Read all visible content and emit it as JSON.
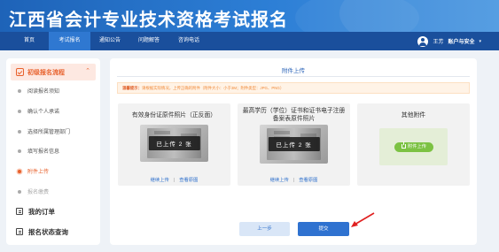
{
  "header": {
    "title": "江西省会计专业技术资格考试报名"
  },
  "nav": {
    "items": [
      {
        "label": "首页",
        "active": false
      },
      {
        "label": "考试报名",
        "active": true
      },
      {
        "label": "通知公告",
        "active": false
      },
      {
        "label": "问题解答",
        "active": false
      },
      {
        "label": "咨询电话",
        "active": false
      }
    ],
    "user_name": "王芳",
    "account_label": "账户与安全",
    "account_caret": "▾"
  },
  "sidebar": {
    "section_title": "初级报名流程",
    "collapse_arrow": "⌃",
    "steps": [
      {
        "label": "阅读报名须知",
        "state": "done"
      },
      {
        "label": "确认个人承诺",
        "state": "done"
      },
      {
        "label": "选择所属管理部门",
        "state": "done"
      },
      {
        "label": "填写报名信息",
        "state": "done"
      },
      {
        "label": "附件上传",
        "state": "active"
      },
      {
        "label": "报名缴费",
        "state": "pending"
      }
    ],
    "links": [
      {
        "label": "我的订单",
        "icon": "receipt-icon"
      },
      {
        "label": "报名状态查询",
        "icon": "status-icon"
      }
    ]
  },
  "main": {
    "title": "附件上传",
    "hint_label": "温馨提示：",
    "hint_text": "请根据实际情况，上传正确的附件（附件大小：小于3M；附件类型：JPG、PNG）",
    "cards": [
      {
        "title": "有效身份证原件照片（正反面）",
        "badge": "已上传 2 张",
        "link_continue": "继续上传",
        "link_view": "查看原图"
      },
      {
        "title": "最高学历（学位）证书和证书电子注册备案表原件照片",
        "badge": "已上传 2 张",
        "link_continue": "继续上传",
        "link_view": "查看原图"
      },
      {
        "title": "其他附件",
        "upload_label": "附件上传"
      }
    ],
    "link_separator": "|",
    "prev_button": "上一步",
    "submit_button": "提交"
  },
  "colors": {
    "brand_blue": "#1a4f9c",
    "active_orange": "#e8612c",
    "upload_green": "#7cc243",
    "annotation_red": "#e02020"
  }
}
